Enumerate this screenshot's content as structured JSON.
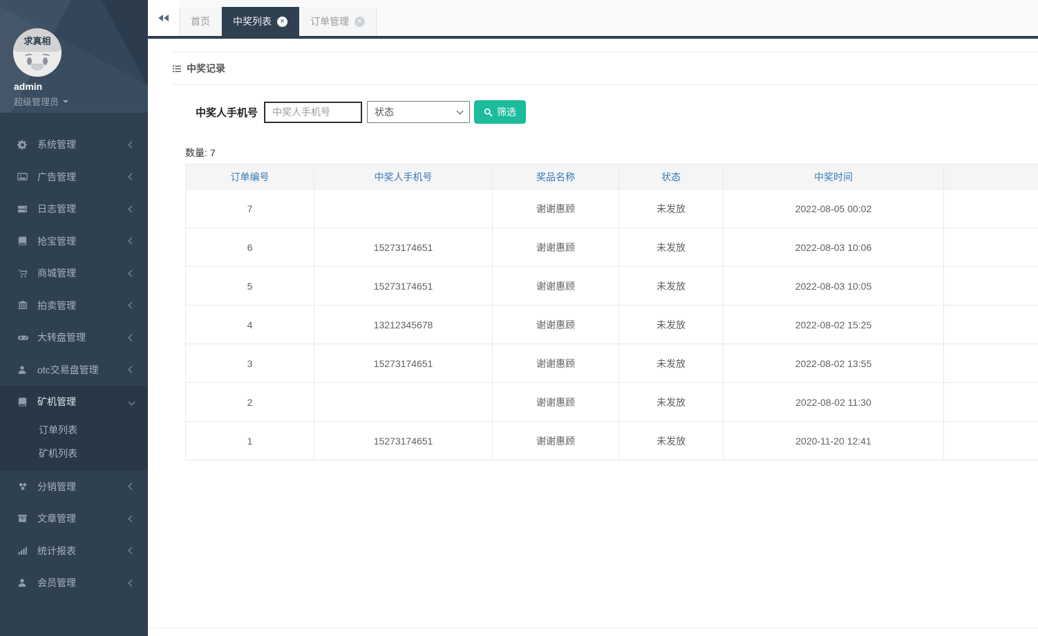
{
  "sidebar": {
    "profile": {
      "avatar_text": "求真相",
      "username": "admin",
      "role": "超级管理员"
    },
    "items": [
      {
        "key": "system",
        "label": "系统管理",
        "icon": "gear-icon",
        "chevron": "left"
      },
      {
        "key": "ads",
        "label": "广告管理",
        "icon": "image-icon",
        "chevron": "left"
      },
      {
        "key": "logs",
        "label": "日志管理",
        "icon": "server-icon",
        "chevron": "left"
      },
      {
        "key": "treasure",
        "label": "抢宝管理",
        "icon": "book-icon",
        "chevron": "left"
      },
      {
        "key": "mall",
        "label": "商城管理",
        "icon": "cart-icon",
        "chevron": "left"
      },
      {
        "key": "auction",
        "label": "拍卖管理",
        "icon": "bank-icon",
        "chevron": "left"
      },
      {
        "key": "wheel",
        "label": "大转盘管理",
        "icon": "gamepad-icon",
        "chevron": "left"
      },
      {
        "key": "otc",
        "label": "otc交易盘管理",
        "icon": "user-icon",
        "chevron": "left"
      },
      {
        "key": "miner",
        "label": "矿机管理",
        "icon": "book-icon",
        "chevron": "down",
        "expanded": true,
        "children": [
          {
            "key": "order-list",
            "label": "订单列表"
          },
          {
            "key": "miner-list",
            "label": "矿机列表"
          }
        ]
      },
      {
        "key": "distribution",
        "label": "分销管理",
        "icon": "share-nodes-icon",
        "chevron": "left"
      },
      {
        "key": "articles",
        "label": "文章管理",
        "icon": "archive-icon",
        "chevron": "left"
      },
      {
        "key": "reports",
        "label": "统计报表",
        "icon": "bar-chart-icon",
        "chevron": "left"
      },
      {
        "key": "members",
        "label": "会员管理",
        "icon": "user-icon",
        "chevron": "left"
      }
    ]
  },
  "tabbar": {
    "tabs": [
      {
        "key": "home",
        "label": "首页",
        "closable": false,
        "active": false
      },
      {
        "key": "prize-list",
        "label": "中奖列表",
        "closable": true,
        "active": true
      },
      {
        "key": "order-mgmt",
        "label": "订单管理",
        "closable": true,
        "active": false
      }
    ]
  },
  "panel": {
    "title": "中奖记录"
  },
  "filter": {
    "label": "中奖人手机号",
    "input_placeholder": "中奖人手机号",
    "select_value": "状态",
    "button_label": "筛选"
  },
  "summary": {
    "count_label": "数量:",
    "count_value": "7"
  },
  "table": {
    "headers": [
      "订单编号",
      "中奖人手机号",
      "奖品名称",
      "状态",
      "中奖时间",
      ""
    ],
    "rows": [
      [
        "7",
        "",
        "谢谢惠顾",
        "未发放",
        "2022-08-05 00:02",
        ""
      ],
      [
        "6",
        "15273174651",
        "谢谢惠顾",
        "未发放",
        "2022-08-03 10:06",
        ""
      ],
      [
        "5",
        "15273174651",
        "谢谢惠顾",
        "未发放",
        "2022-08-03 10:05",
        ""
      ],
      [
        "4",
        "13212345678",
        "谢谢惠顾",
        "未发放",
        "2022-08-02 15:25",
        ""
      ],
      [
        "3",
        "15273174651",
        "谢谢惠顾",
        "未发放",
        "2022-08-02 13:55",
        ""
      ],
      [
        "2",
        "",
        "谢谢惠顾",
        "未发放",
        "2022-08-02 11:30",
        ""
      ],
      [
        "1",
        "15273174651",
        "谢谢惠顾",
        "未发放",
        "2020-11-20 12:41",
        ""
      ]
    ]
  },
  "colors": {
    "sidebar_bg": "#2f4050",
    "sidebar_active_bg": "#293846",
    "sidebar_text": "#a7b1c2",
    "tab_active_bg": "#2f4050",
    "accent_green": "#1bbc9b",
    "table_header_text": "#337ab7",
    "border": "#e7eaec"
  }
}
